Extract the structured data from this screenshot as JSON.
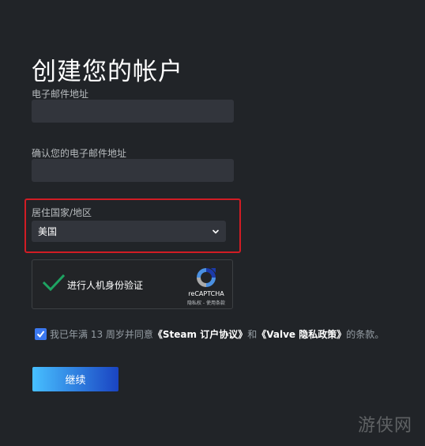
{
  "page": {
    "title": "创建您的帐户"
  },
  "form": {
    "email_label": "电子邮件地址",
    "email_value": "",
    "confirm_email_label": "确认您的电子邮件地址",
    "confirm_email_value": "",
    "country_label": "居住国家/地区",
    "country_value": "美国"
  },
  "captcha": {
    "label": "进行人机身份验证",
    "brand": "reCAPTCHA",
    "links": "隐私权 - 使用条款",
    "verified": true
  },
  "agreement": {
    "checked": true,
    "prefix": "我已年满 13 周岁并同意",
    "ssa_link": "《Steam 订户协议》",
    "conjunction": "和",
    "privacy_link": "《Valve 隐私政策》",
    "suffix": "的条款。"
  },
  "actions": {
    "continue_label": "继续"
  },
  "watermark": {
    "text": "游侠网"
  },
  "colors": {
    "background": "#212428",
    "input_bg": "#32353c",
    "highlight_border": "#d11c24",
    "checkbox_blue": "#3b78f0",
    "button_gradient_start": "#47bfff",
    "button_gradient_end": "#1a44c2",
    "check_green": "#1ea362"
  }
}
